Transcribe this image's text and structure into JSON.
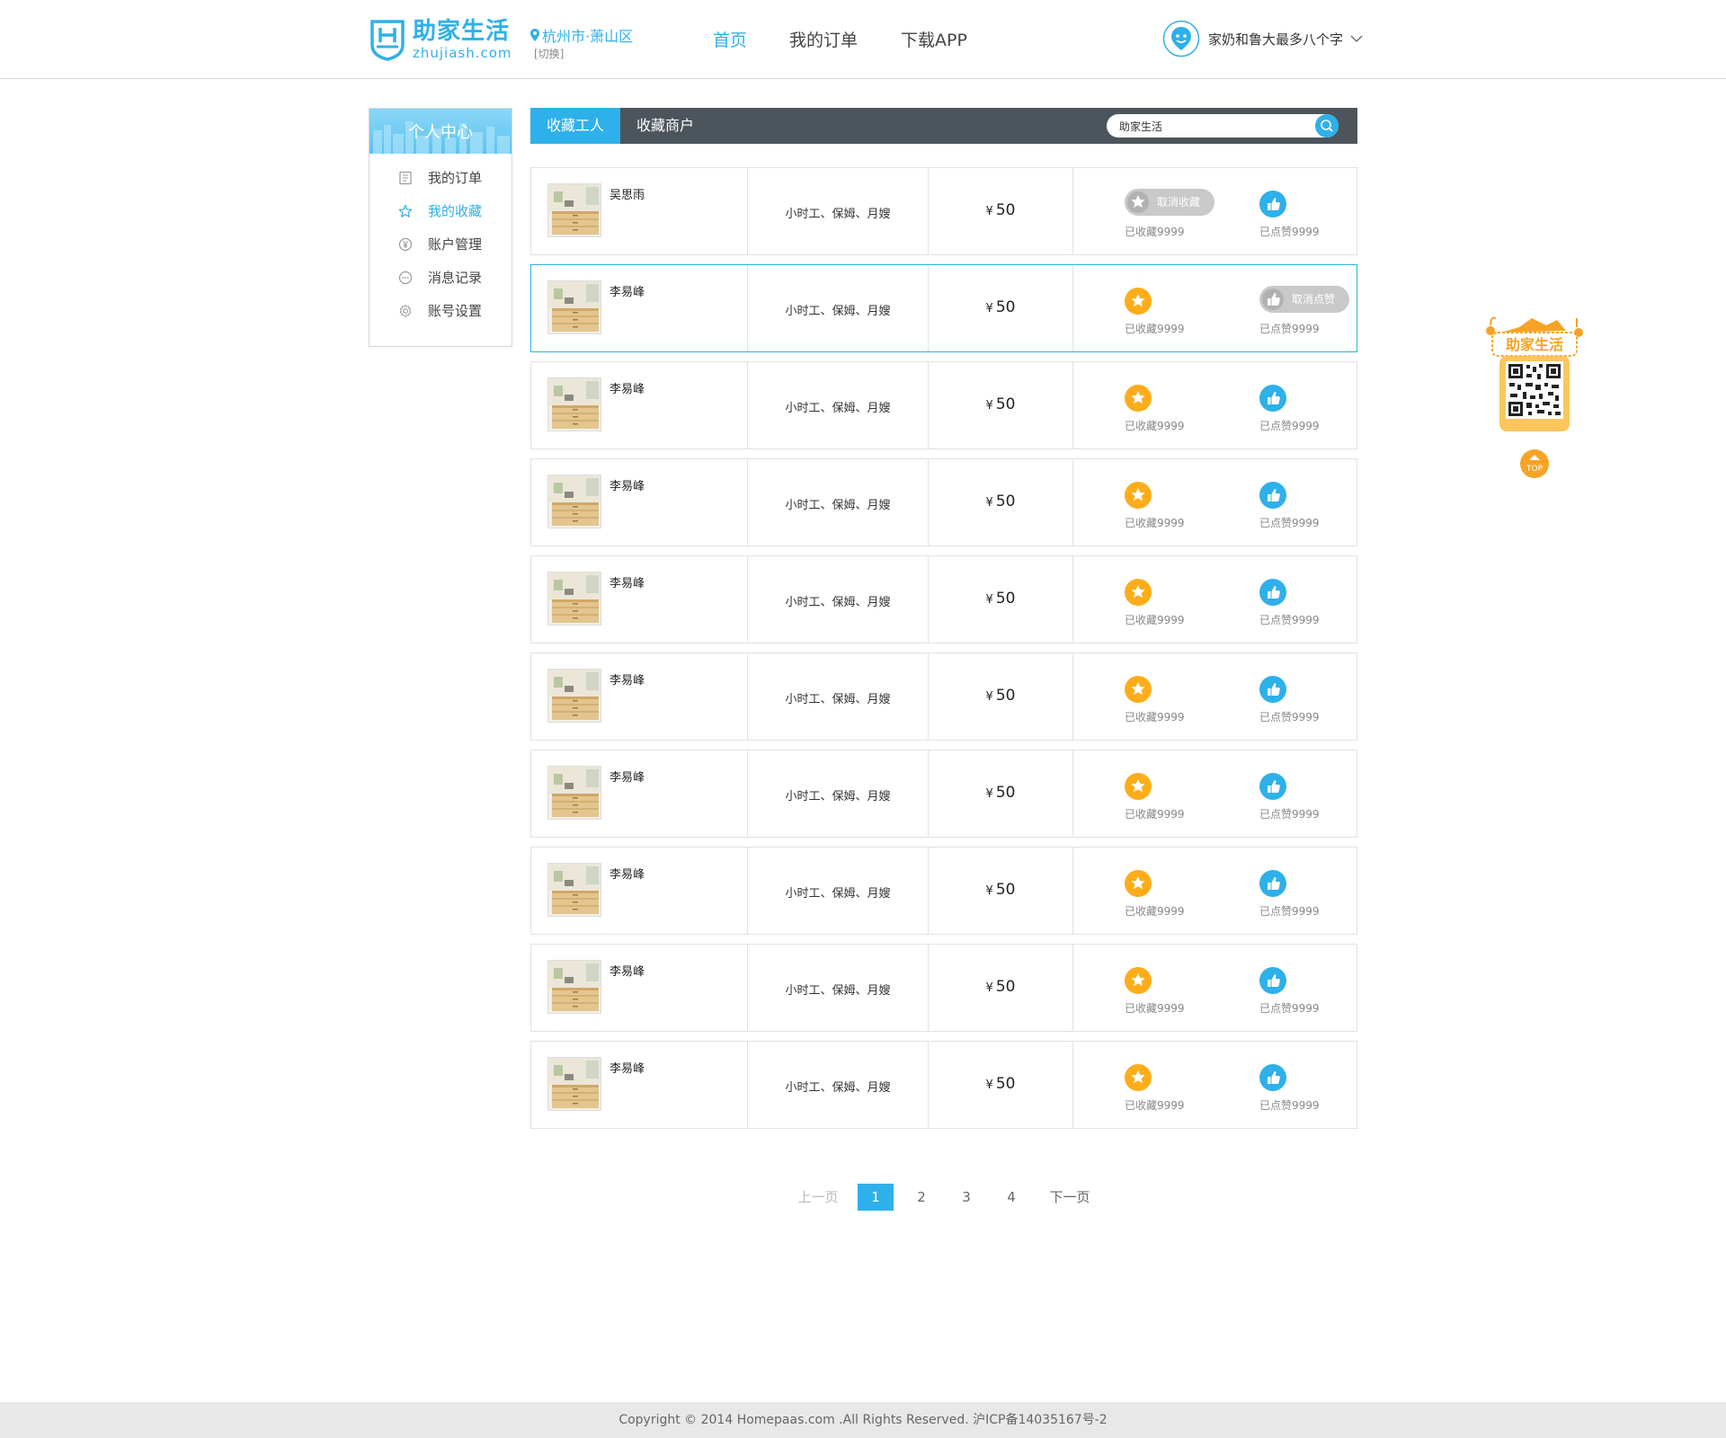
{
  "header": {
    "logo_title": "助家生活",
    "logo_sub": "zhujiash.com",
    "city": "杭州市·萧山区",
    "city_switch": "[切换]",
    "nav": [
      "首页",
      "我的订单",
      "下载APP"
    ],
    "active_nav": "首页",
    "user_name": "家奶和鲁大最多八个字"
  },
  "sidebar": {
    "title": "个人中心",
    "items": [
      {
        "label": "我的订单",
        "icon": "order-list-icon"
      },
      {
        "label": "我的收藏",
        "icon": "star-outline-icon",
        "active": true
      },
      {
        "label": "账户管理",
        "icon": "yuan-coin-icon"
      },
      {
        "label": "消息记录",
        "icon": "chat-bubble-icon"
      },
      {
        "label": "账号设置",
        "icon": "gear-icon"
      }
    ]
  },
  "tabs": {
    "active": "收藏工人",
    "other": "收藏商户"
  },
  "search": {
    "value": "助家生活"
  },
  "rows": [
    {
      "name": "吴思雨",
      "services": "小时工、保姆、月嫂",
      "currency": "¥",
      "price": "50",
      "fav_count": "已收藏9999",
      "like_count": "已点赞9999",
      "fav_button": "取消收藏",
      "like_button": null
    },
    {
      "name": "李易峰",
      "services": "小时工、保姆、月嫂",
      "currency": "¥",
      "price": "50",
      "fav_count": "已收藏9999",
      "like_count": "已点赞9999",
      "fav_button": null,
      "like_button": "取消点赞"
    },
    {
      "name": "李易峰",
      "services": "小时工、保姆、月嫂",
      "currency": "¥",
      "price": "50",
      "fav_count": "已收藏9999",
      "like_count": "已点赞9999",
      "fav_button": null,
      "like_button": null
    },
    {
      "name": "李易峰",
      "services": "小时工、保姆、月嫂",
      "currency": "¥",
      "price": "50",
      "fav_count": "已收藏9999",
      "like_count": "已点赞9999",
      "fav_button": null,
      "like_button": null
    },
    {
      "name": "李易峰",
      "services": "小时工、保姆、月嫂",
      "currency": "¥",
      "price": "50",
      "fav_count": "已收藏9999",
      "like_count": "已点赞9999",
      "fav_button": null,
      "like_button": null
    },
    {
      "name": "李易峰",
      "services": "小时工、保姆、月嫂",
      "currency": "¥",
      "price": "50",
      "fav_count": "已收藏9999",
      "like_count": "已点赞9999",
      "fav_button": null,
      "like_button": null
    },
    {
      "name": "李易峰",
      "services": "小时工、保姆、月嫂",
      "currency": "¥",
      "price": "50",
      "fav_count": "已收藏9999",
      "like_count": "已点赞9999",
      "fav_button": null,
      "like_button": null
    },
    {
      "name": "李易峰",
      "services": "小时工、保姆、月嫂",
      "currency": "¥",
      "price": "50",
      "fav_count": "已收藏9999",
      "like_count": "已点赞9999",
      "fav_button": null,
      "like_button": null
    },
    {
      "name": "李易峰",
      "services": "小时工、保姆、月嫂",
      "currency": "¥",
      "price": "50",
      "fav_count": "已收藏9999",
      "like_count": "已点赞9999",
      "fav_button": null,
      "like_button": null
    },
    {
      "name": "李易峰",
      "services": "小时工、保姆、月嫂",
      "currency": "¥",
      "price": "50",
      "fav_count": "已收藏9999",
      "like_count": "已点赞9999",
      "fav_button": null,
      "like_button": null
    }
  ],
  "selected_row": 1,
  "pager": {
    "prev": "上一页",
    "pages": [
      "1",
      "2",
      "3",
      "4"
    ],
    "current": "1",
    "next": "下一页"
  },
  "float_widget": {
    "brand": "助家生活",
    "top_label": "TOP"
  },
  "footer": {
    "text": "Copyright © 2014 Homepaas.com .All Rights Reserved. 沪ICP备14035167号-2"
  },
  "colors": {
    "accent": "#2eb0ea",
    "favorite": "#fdad1a",
    "tab_bar": "#4c545c",
    "float_orange": "#f7a325"
  }
}
